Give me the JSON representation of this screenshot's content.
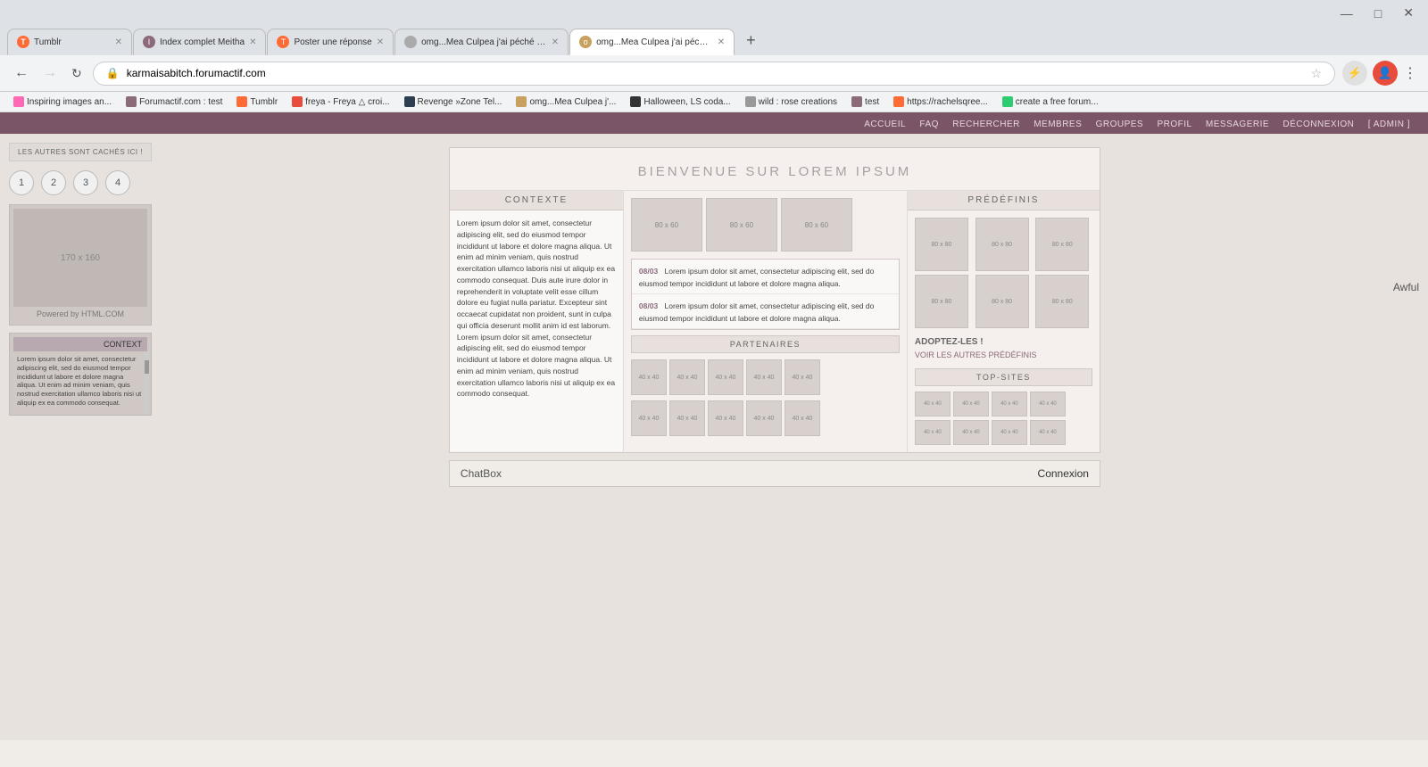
{
  "browser": {
    "tabs": [
      {
        "label": "Tumblr",
        "favicon_color": "#ff6b35",
        "active": false,
        "favicon_letter": "T"
      },
      {
        "label": "Index complet Meitha",
        "favicon_color": "#8b6a7a",
        "active": false,
        "favicon_letter": "I"
      },
      {
        "label": "Poster une réponse",
        "favicon_color": "#ff6b35",
        "active": false,
        "favicon_letter": "T"
      },
      {
        "label": "omg...Mea Culpea j'ai péché ! - B...",
        "favicon_color": "#aaa",
        "active": false,
        "favicon_letter": "o"
      },
      {
        "label": "omg...Mea Culpea j'ai péché !",
        "favicon_color": "#c8a060",
        "active": true,
        "favicon_letter": "o"
      }
    ],
    "address": "karmaisabitch.forumactif.com",
    "new_tab_label": "+",
    "minimize": "—",
    "maximize": "□",
    "close": "✕"
  },
  "bookmarks": [
    {
      "label": "Inspiring images an...",
      "favicon_color": "#ff69b4"
    },
    {
      "label": "Forumactif.com : test",
      "favicon_color": "#8b6a7a"
    },
    {
      "label": "Tumblr",
      "favicon_color": "#ff6b35"
    },
    {
      "label": "freya - Freya △ croi...",
      "favicon_color": "#e74c3c"
    },
    {
      "label": "Revenge »Zone Tel...",
      "favicon_color": "#2c3e50"
    },
    {
      "label": "omg...Mea Culpea j'...",
      "favicon_color": "#c8a060"
    },
    {
      "label": "Halloween, LS coda...",
      "favicon_color": "#333"
    },
    {
      "label": "wild : rose creations",
      "favicon_color": "#999"
    },
    {
      "label": "test",
      "favicon_color": "#8b6a7a"
    },
    {
      "label": "https://rachelsqree...",
      "favicon_color": "#ff6b35"
    },
    {
      "label": "create a free forum...",
      "favicon_color": "#2ecc71"
    }
  ],
  "forum_nav": {
    "items": [
      "ACCUEIL",
      "FAQ",
      "RECHERCHER",
      "MEMBRES",
      "GROUPES",
      "PROFIL",
      "MESSAGERIE",
      "DÉCONNEXION",
      "[ ADMIN ]"
    ]
  },
  "sidebar": {
    "hidden_label": "LES AUTRES SONT CACHÉS ICI !",
    "pages": [
      "1",
      "2",
      "3",
      "4"
    ],
    "thumb_size": "170 x 160",
    "powered": "Powered by HTML.COM",
    "context_label": "CONTEXT"
  },
  "main_panel": {
    "title": "BIENVENUE SUR LOREM IPSUM",
    "context": {
      "header": "CONTEXTE",
      "text": "Lorem ipsum dolor sit amet, consectetur adipiscing elit, sed do eiusmod tempor incididunt ut labore et dolore magna aliqua. Ut enim ad minim veniam, quis nostrud exercitation ullamco laboris nisi ut aliquip ex ea commodo consequat. Duis aute irure dolor in reprehenderit in voluptate velit esse cillum dolore eu fugiat nulla pariatur. Excepteur sint occaecat cupidatat non proident, sunt in culpa qui officia deserunt mollit anim id est laborum. Lorem ipsum dolor sit amet, consectetur adipiscing elit, sed do eiusmod tempor incididunt ut labore et dolore magna aliqua. Ut enim ad minim veniam, quis nostrud exercitation ullamco laboris nisi ut aliquip ex ea commodo consequat."
    },
    "images": [
      {
        "size": "80 x 60"
      },
      {
        "size": "80 x 60"
      },
      {
        "size": "80 x 60"
      }
    ],
    "news": [
      {
        "date": "08/03",
        "text": "Lorem ipsum dolor sit amet, consectetur adipiscing elit, sed do eiusmod tempor incididunt ut labore et dolore magna aliqua."
      },
      {
        "date": "08/03",
        "text": "Lorem ipsum dolor sit amet, consectetur adipiscing elit, sed do eiusmod tempor incididunt ut labore et dolore magna aliqua."
      }
    ],
    "partners": {
      "header": "PARTENAIRES",
      "row1_count": 5,
      "row2_count": 5,
      "size": "40 x 40"
    },
    "predefinis": {
      "header": "PRÉDÉFINIS",
      "grid_count": 6,
      "size": "80 x 80",
      "adopt_label": "ADOPTEZ-LES !",
      "voir_autres": "VOIR LES AUTRES PRÉDÉFINIS"
    },
    "top_sites": {
      "header": "TOP-SITES",
      "row1_count": 4,
      "row2_count": 4,
      "size": "40 x 40"
    },
    "awful_label": "Awful"
  },
  "chatbox": {
    "label": "ChatBox",
    "connexion": "Connexion"
  },
  "lorem_text": "Lorem ipsum dolor sit amet, consectetur adipiscing elit, sed do eiusmod tempor incididunt ut labore et dolore magna aliqua. Ut enim ad minim veniam, quis nostrud exercitation ullamco laboris nisi ut aliquip ex ea commodo consequat."
}
